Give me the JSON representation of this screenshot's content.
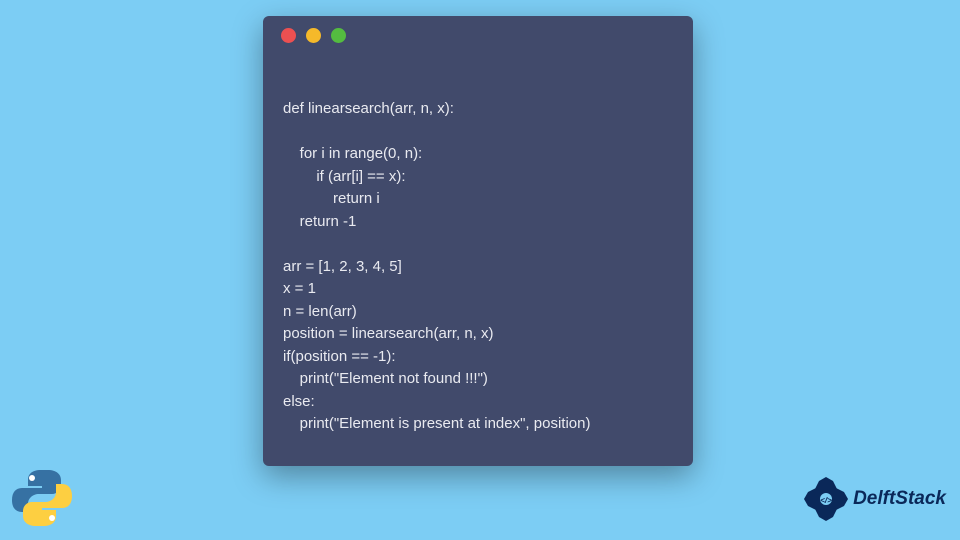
{
  "window": {
    "dots": {
      "red": "#ec5051",
      "yellow": "#f5b92a",
      "green": "#54bc40"
    }
  },
  "code": {
    "lines": [
      "def linearsearch(arr, n, x):",
      "",
      "    for i in range(0, n):",
      "        if (arr[i] == x):",
      "            return i",
      "    return -1",
      "",
      "arr = [1, 2, 3, 4, 5]",
      "x = 1",
      "n = len(arr)",
      "position = linearsearch(arr, n, x)",
      "if(position == -1):",
      "    print(\"Element not found !!!\")",
      "else:",
      "    print(\"Element is present at index\", position)"
    ]
  },
  "logos": {
    "python_icon": "python-icon",
    "delftstack_icon": "delftstack-icon",
    "delftstack_text": "DelftStack"
  }
}
